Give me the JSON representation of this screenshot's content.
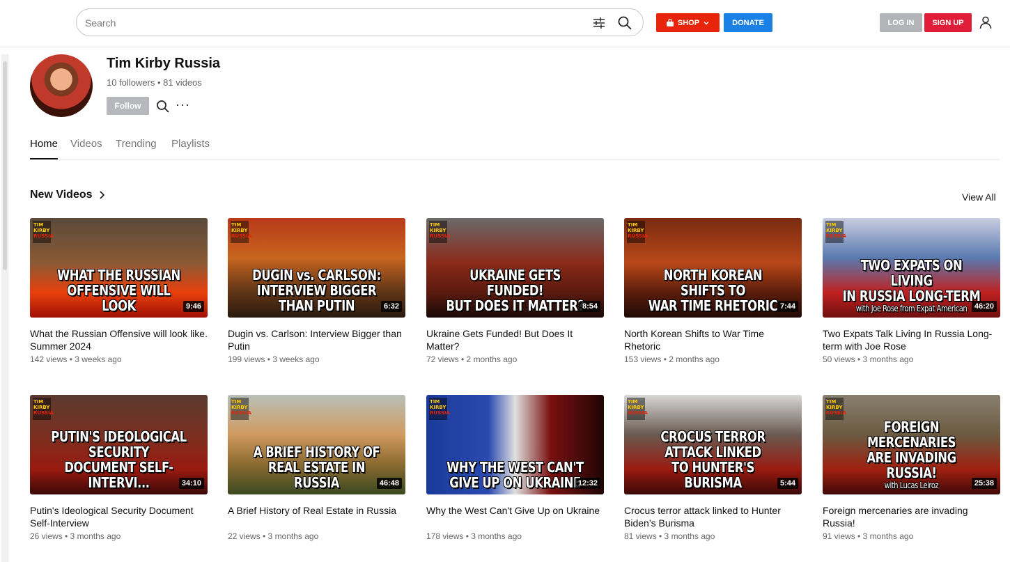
{
  "search": {
    "placeholder": "Search"
  },
  "header": {
    "shop_label": "SHOP",
    "donate_label": "DONATE",
    "login_label": "LOG IN",
    "signup_label": "SIGN UP"
  },
  "channel": {
    "name": "Tim Kirby Russia",
    "meta": "10 followers • 81 videos",
    "follow_label": "Follow",
    "more_label": "···"
  },
  "tabs": [
    {
      "label": "Home",
      "active": true
    },
    {
      "label": "Videos",
      "active": false
    },
    {
      "label": "Trending",
      "active": false
    },
    {
      "label": "Playlists",
      "active": false
    }
  ],
  "section": {
    "title": "New Videos",
    "view_all": "View All"
  },
  "videos": [
    {
      "title": "What the Russian Offensive will look like. Summer 2024",
      "meta": "142 views • 3 weeks ago",
      "duration": "9:46",
      "overlay": [
        "WHAT THE RUSSIAN",
        "OFFENSIVE WILL LOOK"
      ],
      "bg": "linear-gradient(180deg,#5a4a3a 0%,#8a5a35 45%,#e8400c 75%,#a01005 100%)"
    },
    {
      "title": "Dugin vs. Carlson: Interview Bigger than Putin",
      "meta": "199 views • 3 weeks ago",
      "duration": "6:32",
      "overlay": [
        "DUGIN vs. CARLSON:",
        "INTERVIEW BIGGER THAN PUTIN"
      ],
      "bg": "linear-gradient(180deg,#b83a1a 0%,#c8651f 40%,#6a3a18 70%,#2a1a0e 100%)"
    },
    {
      "title": "Ukraine Gets Funded! But Does It Matter?",
      "meta": "72 views • 2 months ago",
      "duration": "8:54",
      "overlay": [
        "UKRAINE GETS FUNDED!",
        "BUT DOES IT MATTER?"
      ],
      "bg": "linear-gradient(180deg,#6b6b6b 0%,#8a2a1a 45%,#5a1a0e 75%,#1a0a08 100%)"
    },
    {
      "title": "North Korean Shifts to War Time Rhetoric",
      "meta": "153 views • 2 months ago",
      "duration": "7:44",
      "overlay": [
        "NORTH KOREAN SHIFTS TO",
        "WAR TIME RHETORIC"
      ],
      "bg": "linear-gradient(180deg,#7a2a10 0%,#b8481a 45%,#5a1c0a 75%,#200a05 100%)"
    },
    {
      "title": "Two Expats Talk Living In Russia Long-term with Joe Rose",
      "meta": "50 views • 3 months ago",
      "duration": "46:20",
      "overlay": [
        "TWO EXPATS ON LIVING",
        "IN RUSSIA LONG-TERM"
      ],
      "sub": "with Joe Rose from Expat American",
      "bg": "linear-gradient(180deg,#c9cde0 0%,#5a7ab0 40%,#c02020 75%,#701010 100%)"
    },
    {
      "title": "Putin's Ideological Security Document Self-Interview",
      "meta": "26 views • 3 months ago",
      "duration": "34:10",
      "overlay": [
        "PUTIN'S IDEOLOGICAL SECURITY",
        "DOCUMENT SELF-INTERVI..."
      ],
      "bg": "linear-gradient(180deg,#5a3a30 0%,#7a3020 40%,#9a1a10 75%,#3a0808 100%)"
    },
    {
      "title": "A Brief History of Real Estate in Russia",
      "meta": "22 views • 3 months ago",
      "duration": "46:48",
      "overlay": [
        "A BRIEF HISTORY OF",
        "REAL ESTATE IN RUSSIA"
      ],
      "bg": "linear-gradient(180deg,#b8c0b8 0%,#d09a60 40%,#8a6a30 70%,#3a4a20 100%)"
    },
    {
      "title": "Why the West Can't Give Up on Ukraine",
      "meta": "178 views • 3 months ago",
      "duration": "12:32",
      "overlay": [
        "WHY THE WEST CAN'T",
        "GIVE UP ON UKRAINE"
      ],
      "bg": "linear-gradient(90deg,#1a3a9a 0%,#2a4ab0 35%,#e0e0e0 50%,#7a1010 70%,#200505 100%)"
    },
    {
      "title": "Crocus terror attack linked to Hunter Biden’s Burisma",
      "meta": "81 views • 3 months ago",
      "duration": "5:44",
      "overlay": [
        "CROCUS TERROR ATTACK LINKED",
        "TO HUNTER'S BURISMA"
      ],
      "bg": "linear-gradient(180deg,#d8d8d8 0%,#6a5a50 40%,#9a1a10 75%,#3a0808 100%)"
    },
    {
      "title": "Foreign mercenaries are invading Russia!",
      "meta": "91 views • 3 months ago",
      "duration": "25:38",
      "overlay": [
        "FOREIGN MERCENARIES",
        "ARE INVADING RUSSIA!"
      ],
      "sub": "with Lucas Leiroz",
      "bg": "linear-gradient(180deg,#8a8070 0%,#6a5a40 40%,#a02010 75%,#400808 100%)"
    }
  ]
}
